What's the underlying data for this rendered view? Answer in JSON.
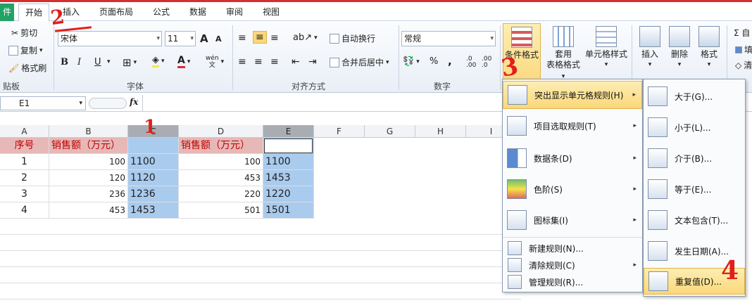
{
  "tabs": [
    "开始",
    "插入",
    "页面布局",
    "公式",
    "数据",
    "审阅",
    "视图"
  ],
  "file_tab": "件",
  "clipboard": {
    "cut": "剪切",
    "copy": "复制",
    "format_painter": "格式刷",
    "group": "贴板"
  },
  "font": {
    "name": "宋体",
    "size": "11",
    "group": "字体",
    "bold": "B",
    "italic": "I",
    "underline": "U",
    "grow": "A",
    "shrink": "A",
    "wen": "wén"
  },
  "alignment": {
    "wrap": "自动换行",
    "merge": "合并后居中",
    "group": "对齐方式"
  },
  "number": {
    "format": "常规",
    "group": "数字",
    "percent": "%",
    "comma": ","
  },
  "styles": {
    "conditional": "条件格式",
    "table_format_1": "套用",
    "table_format_2": "表格格式",
    "cell_styles": "单元格样式"
  },
  "cells": {
    "insert": "插入",
    "delete": "删除",
    "format": "格式"
  },
  "editing": {
    "sum": "Σ 自",
    "fill": "填",
    "clear": "清"
  },
  "formula_bar": {
    "name_box": "E1",
    "fx": "fx"
  },
  "columns": [
    "A",
    "B",
    "C",
    "D",
    "E",
    "F",
    "G",
    "H",
    "I"
  ],
  "rows": [
    {
      "a": "序号",
      "b": "销售额（万元）",
      "c": "",
      "d": "销售额（万元）",
      "e": ""
    },
    {
      "a": "1",
      "b": "100",
      "c": "1100",
      "d": "100",
      "e": "1100"
    },
    {
      "a": "2",
      "b": "120",
      "c": "1120",
      "d": "453",
      "e": "1453"
    },
    {
      "a": "3",
      "b": "236",
      "c": "1236",
      "d": "220",
      "e": "1220"
    },
    {
      "a": "4",
      "b": "453",
      "c": "1453",
      "d": "501",
      "e": "1501"
    }
  ],
  "menu1": [
    {
      "label": "突出显示单元格规则(H)",
      "icon": "highlight-rules-icon"
    },
    {
      "label": "项目选取规则(T)",
      "icon": "top-bottom-rules-icon"
    },
    {
      "label": "数据条(D)",
      "icon": "data-bars-icon"
    },
    {
      "label": "色阶(S)",
      "icon": "color-scales-icon"
    },
    {
      "label": "图标集(I)",
      "icon": "icon-sets-icon"
    },
    {
      "label": "新建规则(N)...",
      "icon": "new-rule-icon"
    },
    {
      "label": "清除规则(C)",
      "icon": "clear-rules-icon"
    },
    {
      "label": "管理规则(R)...",
      "icon": "manage-rules-icon"
    }
  ],
  "menu2": [
    {
      "label": "大于(G)...",
      "icon": "greater-than-icon"
    },
    {
      "label": "小于(L)...",
      "icon": "less-than-icon"
    },
    {
      "label": "介于(B)...",
      "icon": "between-icon"
    },
    {
      "label": "等于(E)...",
      "icon": "equal-to-icon"
    },
    {
      "label": "文本包含(T)...",
      "icon": "text-contains-icon"
    },
    {
      "label": "发生日期(A)...",
      "icon": "date-occurring-icon"
    },
    {
      "label": "重复值(D)...",
      "icon": "duplicate-values-icon"
    }
  ],
  "annotations": [
    "1",
    "2",
    "3",
    "4"
  ],
  "colors": {
    "header_fill": "#e6b8b7",
    "selection": "#a9cbee",
    "highlight": "#fbd77a",
    "annotation": "#e0201a"
  }
}
